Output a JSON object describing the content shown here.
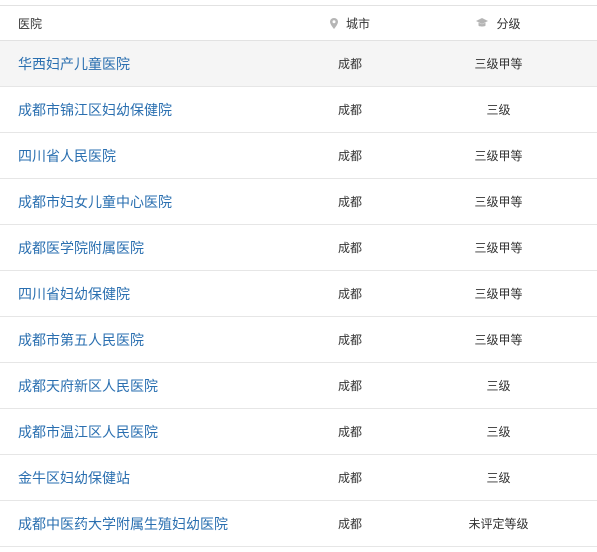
{
  "header": {
    "name": "医院",
    "city": "城市",
    "level": "分级",
    "city_icon": "location-pin-icon",
    "level_icon": "graduation-cap-icon"
  },
  "rows": [
    {
      "name": "华西妇产儿童医院",
      "city": "成都",
      "level": "三级甲等"
    },
    {
      "name": "成都市锦江区妇幼保健院",
      "city": "成都",
      "level": "三级"
    },
    {
      "name": "四川省人民医院",
      "city": "成都",
      "level": "三级甲等"
    },
    {
      "name": "成都市妇女儿童中心医院",
      "city": "成都",
      "level": "三级甲等"
    },
    {
      "name": "成都医学院附属医院",
      "city": "成都",
      "level": "三级甲等"
    },
    {
      "name": "四川省妇幼保健院",
      "city": "成都",
      "level": "三级甲等"
    },
    {
      "name": "成都市第五人民医院",
      "city": "成都",
      "level": "三级甲等"
    },
    {
      "name": "成都天府新区人民医院",
      "city": "成都",
      "level": "三级"
    },
    {
      "name": "成都市温江区人民医院",
      "city": "成都",
      "level": "三级"
    },
    {
      "name": "金牛区妇幼保健站",
      "city": "成都",
      "level": "三级"
    },
    {
      "name": "成都中医药大学附属生殖妇幼医院",
      "city": "成都",
      "level": "未评定等级"
    }
  ],
  "colors": {
    "link": "#2a6fb0",
    "text": "#333333",
    "highlight_row": "#f5f5f5",
    "border": "#e6e6e6",
    "icon": "#b5b5b5"
  }
}
